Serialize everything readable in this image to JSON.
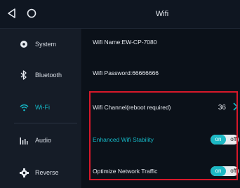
{
  "header": {
    "title": "Wifi",
    "back_icon": "back-triangle-icon",
    "home_icon": "home-circle-icon"
  },
  "sidebar": {
    "items": [
      {
        "label": "System",
        "icon": "gear-icon"
      },
      {
        "label": "Bluetooth",
        "icon": "bluetooth-icon"
      },
      {
        "label": "Wi-Fi",
        "icon": "wifi-icon",
        "active": true
      },
      {
        "label": "Audio",
        "icon": "equalizer-icon"
      },
      {
        "label": "Reverse",
        "icon": "gear-icon"
      }
    ]
  },
  "main": {
    "wifi_name": "Wifi Name:EW-CP-7080",
    "wifi_password": "Wifi Password:66666666",
    "channel": {
      "label": "Wifi Channel(reboot required)",
      "value": "36"
    },
    "stability": {
      "label": "Enhanced Wifi Stability",
      "on_label": "on",
      "off_label": "off"
    },
    "traffic": {
      "label": "Optimize Network Traffic",
      "on_label": "on",
      "off_label": "off"
    }
  },
  "colors": {
    "accent": "#15b9c7",
    "background": "#0b1119",
    "sidebar": "#151c27",
    "highlight_box": "#d7182a"
  }
}
